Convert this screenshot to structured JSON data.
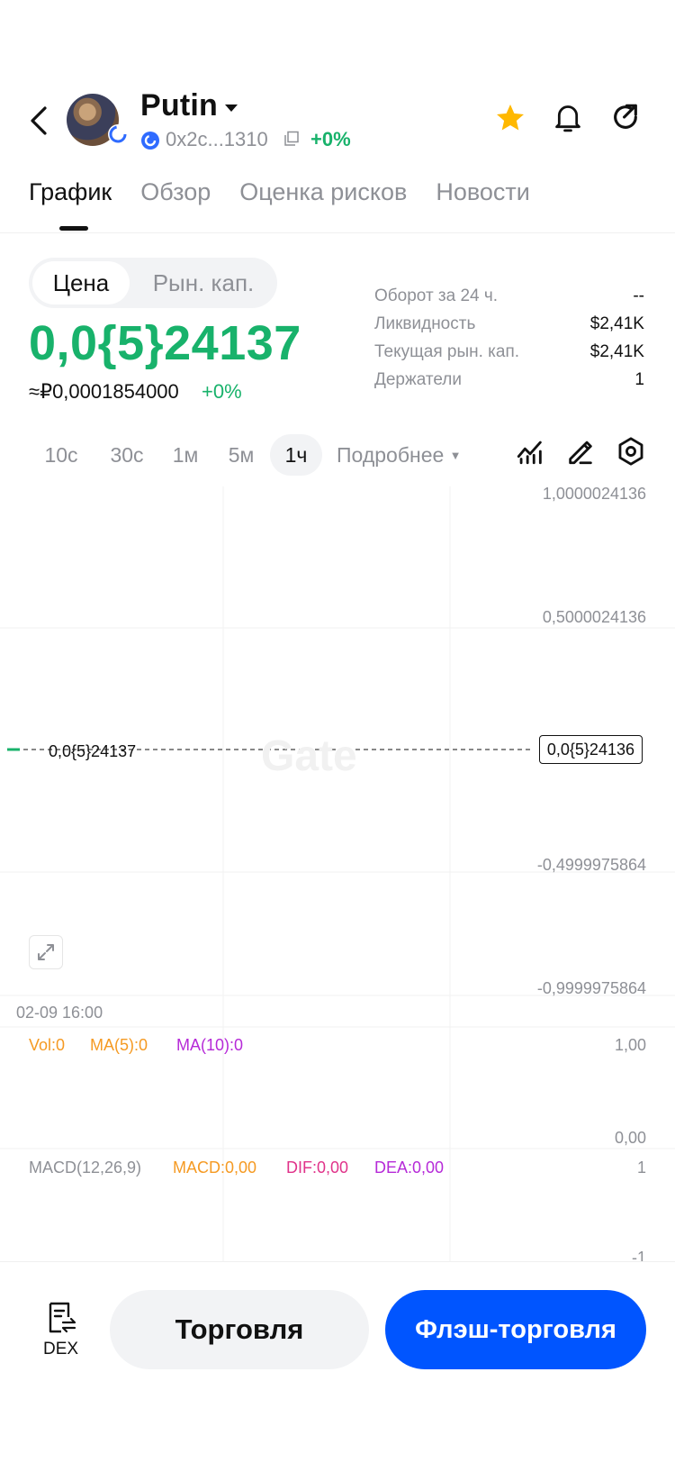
{
  "header": {
    "title": "Putin",
    "address": "0x2c...1310",
    "address_change": "+0%",
    "icons": [
      "back-icon",
      "star-icon",
      "bell-icon",
      "share-icon"
    ],
    "star_color": "#ffb800"
  },
  "tabs": [
    {
      "label": "График",
      "active": true
    },
    {
      "label": "Обзор"
    },
    {
      "label": "Оценка рисков"
    },
    {
      "label": "Новости"
    }
  ],
  "toggle": {
    "price": "Цена",
    "mcap": "Рын. кап."
  },
  "price": {
    "main": "0,0{5}24137",
    "fiat": "≈₽0,0001854000",
    "change": "+0%"
  },
  "stats": [
    {
      "label": "Оборот за 24 ч.",
      "value": "--"
    },
    {
      "label": "Ликвидность",
      "value": "$2,41K"
    },
    {
      "label": "Текущая рын. кап.",
      "value": "$2,41K"
    },
    {
      "label": "Держатели",
      "value": "1"
    }
  ],
  "intervals": [
    "10с",
    "30с",
    "1м",
    "5м",
    "1ч"
  ],
  "active_interval": "1ч",
  "more": "Подробнее",
  "chart": {
    "y_axis": [
      "1,0000024136",
      "0,5000024136",
      "-0,4999975864",
      "-0,9999975864"
    ],
    "current_left": "0,0{5}24137",
    "current_tag": "0,0{5}24136",
    "date": "02-09 16:00",
    "watermark": "Gate",
    "vol": {
      "vol": "Vol:0",
      "ma5": "MA(5):0",
      "ma10": "MA(10):0",
      "top": "1,00",
      "bottom": "0,00"
    },
    "macd": {
      "name": "MACD(12,26,9)",
      "macd": "MACD:0,00",
      "dif": "DIF:0,00",
      "dea": "DEA:0,00",
      "top": "1",
      "bottom": "-1"
    }
  },
  "bottom": {
    "dex": "DEX",
    "trade": "Торговля",
    "flash": "Флэш-торговля"
  },
  "colors": {
    "green": "#18b26b",
    "blue": "#0055ff",
    "orange": "#f59a23",
    "purple": "#b62ad8",
    "pink": "#e0338a"
  }
}
